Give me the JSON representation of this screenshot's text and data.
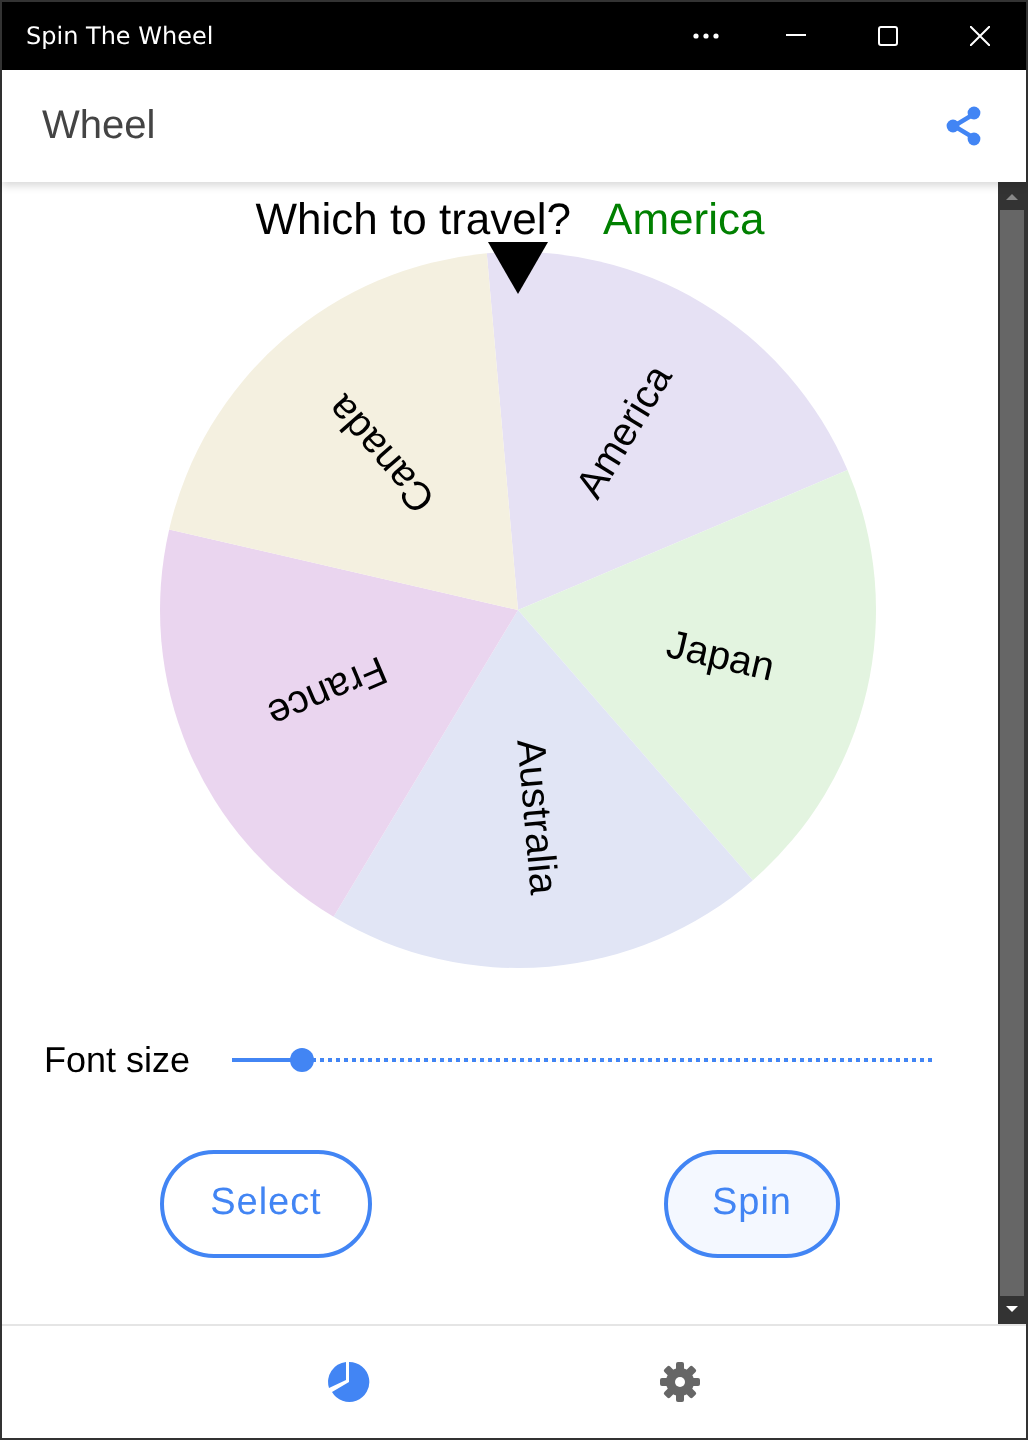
{
  "window": {
    "title": "Spin The Wheel"
  },
  "app_bar": {
    "title": "Wheel"
  },
  "question": {
    "label": "Which to travel?",
    "result": "America"
  },
  "wheel": {
    "segments": [
      {
        "label": "America",
        "color": "#e6e1f4"
      },
      {
        "label": "Japan",
        "color": "#e3f4e0"
      },
      {
        "label": "Australia",
        "color": "#e1e5f5"
      },
      {
        "label": "France",
        "color": "#ead5ef"
      },
      {
        "label": "Canada",
        "color": "#f4f0e0"
      }
    ]
  },
  "font_size": {
    "label": "Font size",
    "level": 0.1
  },
  "buttons": [
    {
      "label": "Select"
    },
    {
      "label": "Spin"
    }
  ],
  "bottom_nav": [
    {
      "kind": "wheel",
      "selected": true
    },
    {
      "kind": "settings",
      "selected": false
    }
  ]
}
